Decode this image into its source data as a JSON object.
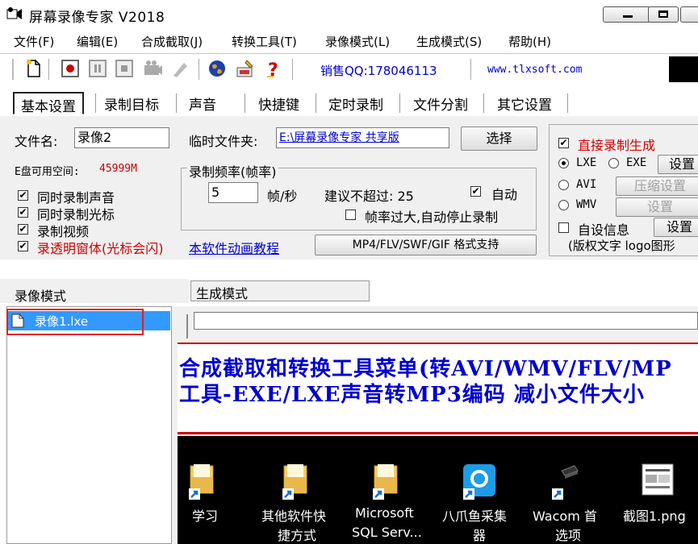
{
  "window": {
    "title": "屏幕录像专家 V2018"
  },
  "menu": [
    "文件(F)",
    "编辑(E)",
    "合成截取(J)",
    "转换工具(T)",
    "录像模式(L)",
    "生成模式(S)",
    "帮助(H)"
  ],
  "toolbar": {
    "sales_qq": "销售QQ:178046113",
    "website": "www.tlxsoft.com"
  },
  "tabs": [
    "基本设置",
    "录制目标",
    "声音",
    "快捷键",
    "定时录制",
    "文件分割",
    "其它设置"
  ],
  "settings": {
    "filename_label": "文件名:",
    "filename_value": "录像2",
    "temp_folder_label": "临时文件夹:",
    "temp_folder_value": "E:\\屏幕录像专家 共享版 ",
    "choose_button": "选择",
    "disk_label": "E盘可用空间:",
    "disk_value": "45999M",
    "frame_rate_group": "录制频率(帧率)",
    "frame_rate_value": "5",
    "frame_rate_unit": "帧/秒",
    "recommend_label": "建议不超过: 25",
    "auto_label": "自动",
    "auto_checked": true,
    "stop_on_high_label": "帧率过大,自动停止录制",
    "stop_on_high_checked": false,
    "checkboxes": [
      {
        "label": "同时录制声音",
        "checked": true,
        "color": "#000000"
      },
      {
        "label": "同时录制光标",
        "checked": true,
        "color": "#000000"
      },
      {
        "label": "录制视频",
        "checked": true,
        "color": "#000000"
      },
      {
        "label": "录透明窗体(光标会闪)",
        "checked": true,
        "color": "#cc0000"
      }
    ],
    "tutorial_link": "本软件动画教程",
    "format_button": "MP4/FLV/SWF/GIF  格式支持"
  },
  "output": {
    "direct_generate_label": "直接录制生成",
    "direct_generate_checked": true,
    "formats": [
      {
        "label": "LXE",
        "selected": true
      },
      {
        "label": "EXE",
        "selected": false
      },
      {
        "label": "AVI",
        "selected": false
      },
      {
        "label": "WMV",
        "selected": false
      }
    ],
    "settings_button": "设置",
    "compress_settings_button": "压缩设置",
    "wmv_settings_button": "设置",
    "custom_info_label": "自设信息",
    "custom_info_checked": false,
    "custom_settings_button": "设置",
    "copyright_label": "(版权文字 logo图形"
  },
  "lower": {
    "record_mode_header": "录像模式",
    "generate_mode_header": "生成模式",
    "files": [
      "录像1.lxe"
    ]
  },
  "banner": {
    "line1": "合成截取和转换工具菜单(转AVI/WMV/FLV/MP",
    "line2": "工具-EXE/LXE声音转MP3编码 减小文件大小"
  },
  "desktop": {
    "icons": [
      {
        "label": "学习",
        "label2": "",
        "icon": "folder-shortcut-icon"
      },
      {
        "label": "其他软件快",
        "label2": "捷方式",
        "icon": "folder-shortcut-icon"
      },
      {
        "label": "Microsoft",
        "label2": "SQL Serv...",
        "icon": "folder-shortcut-icon"
      },
      {
        "label": "八爪鱼采集",
        "label2": "器",
        "icon": "app-shortcut-icon"
      },
      {
        "label": "Wacom 首",
        "label2": "选项",
        "icon": "wacom-shortcut-icon"
      },
      {
        "label": "截图1.png",
        "label2": "",
        "icon": "image-file-icon"
      }
    ]
  }
}
